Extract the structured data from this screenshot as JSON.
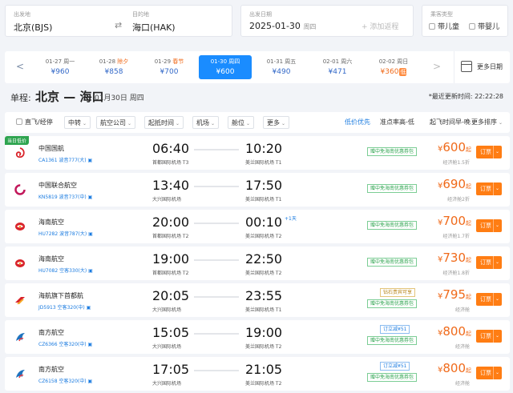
{
  "search": {
    "from_label": "出发地",
    "from_value": "北京(BJS)",
    "to_label": "目的地",
    "to_value": "海口(HAK)",
    "date_label": "出发日期",
    "date_value": "2025-01-30",
    "date_weekday": "周四",
    "return_placeholder": "+ 添加返程",
    "passenger_label": "乘客类型",
    "child_label": "带儿童",
    "infant_label": "带婴儿",
    "swap_icon": "swap-icon"
  },
  "datebar": {
    "prev_icon": "chevron-left-icon",
    "next_icon": "chevron-right-icon",
    "more_label": "更多日期",
    "days": [
      {
        "date": "01-27",
        "day": "周一",
        "price": "¥960"
      },
      {
        "date": "01-28",
        "day": "除夕",
        "price": "¥858"
      },
      {
        "date": "01-29",
        "day": "春节",
        "price": "¥700"
      },
      {
        "date": "01-30",
        "day": "周四",
        "price": "¥600"
      },
      {
        "date": "01-31",
        "day": "周五",
        "price": "¥490"
      },
      {
        "date": "02-01",
        "day": "周六",
        "price": "¥471"
      },
      {
        "date": "02-02",
        "day": "周日",
        "price": "¥360",
        "low": "低"
      }
    ]
  },
  "route": {
    "type": "单程:",
    "cities": "北京 — 海口",
    "date": "01月30日 周四",
    "updated": "*最近更新时间: 22:22:28"
  },
  "filters": {
    "direct": "直飞/经停",
    "transfer": "中转",
    "airline": "航空公司",
    "dep_time": "起抵时间",
    "airport": "机场",
    "cabin": "舱位",
    "more": "更多",
    "low_price": "低价优先",
    "ontime": "准点率高-低",
    "dep_sort": "起飞时间早-晚",
    "more_sort": "更多排序"
  },
  "flights": [
    {
      "badge": "当日低价",
      "airline": "中国国航",
      "info": "CA1361 波音777(大)",
      "logo": "air-china-logo-icon",
      "logo_color": "#d9232a",
      "dep": "06:40",
      "dep_ap": "首都国际机场 T3",
      "arr": "10:20",
      "arr_ap": "美兰国际机场 T1",
      "tags": [
        "赠中免海南优惠券包"
      ],
      "price": "600",
      "cabin": "经济舱1.5折"
    },
    {
      "airline": "中国联合航空",
      "info": "KN5819 波音737(中)",
      "logo": "china-united-logo-icon",
      "logo_color": "#c2185b",
      "dep": "13:40",
      "dep_ap": "大兴国际机场",
      "arr": "17:50",
      "arr_ap": "美兰国际机场 T1",
      "tags": [
        "赠中免海南优惠券包"
      ],
      "price": "690",
      "cabin": "经济舱2折"
    },
    {
      "airline": "海南航空",
      "info": "HU7282 波音787(大)",
      "logo": "hainan-airlines-logo-icon",
      "logo_color": "#d9232a",
      "dep": "20:00",
      "dep_ap": "首都国际机场 T2",
      "arr": "00:10",
      "arr_ap": "美兰国际机场 T2",
      "plus": "+1天",
      "tags": [
        "赠中免海南优惠券包"
      ],
      "price": "700",
      "cabin": "经济舱1.7折"
    },
    {
      "airline": "海南航空",
      "info": "HU7082 空客330(大)",
      "logo": "hainan-airlines-logo-icon",
      "logo_color": "#d9232a",
      "dep": "19:00",
      "dep_ap": "首都国际机场 T2",
      "arr": "22:50",
      "arr_ap": "美兰国际机场 T2",
      "tags": [
        "赠中免海南优惠券包"
      ],
      "price": "730",
      "cabin": "经济舱1.8折"
    },
    {
      "airline": "海航旗下首都航",
      "info": "JD5913 空客320(中)",
      "logo": "capital-airlines-logo-icon",
      "logo_color": "#d9232a",
      "dep": "20:05",
      "dep_ap": "大兴国际机场",
      "arr": "23:55",
      "arr_ap": "美兰国际机场 T1",
      "tags": [
        "钻石贵宾可享",
        "赠中免海南优惠券包"
      ],
      "price": "795",
      "cabin": "经济舱"
    },
    {
      "airline": "南方航空",
      "info": "CZ6366 空客320(中)",
      "logo": "china-southern-logo-icon",
      "logo_color": "#1e73be",
      "dep": "15:05",
      "dep_ap": "大兴国际机场",
      "arr": "19:00",
      "arr_ap": "美兰国际机场 T2",
      "tags": [
        "订立减¥51",
        "赠中免海南优惠券包"
      ],
      "price": "800",
      "cabin": "经济舱"
    },
    {
      "airline": "南方航空",
      "info": "CZ6158 空客320(中)",
      "logo": "china-southern-logo-icon",
      "logo_color": "#1e73be",
      "dep": "17:05",
      "dep_ap": "大兴国际机场",
      "arr": "21:05",
      "arr_ap": "美兰国际机场 T2",
      "tags": [
        "订立减¥51",
        "赠中免海南优惠券包"
      ],
      "price": "800",
      "cabin": "经济舱"
    }
  ],
  "labels": {
    "book": "订票",
    "yen": "¥",
    "qi": "起"
  },
  "colors": {
    "accent": "#1a8cff",
    "price": "#f06a1a",
    "book": "#ff7d13"
  }
}
